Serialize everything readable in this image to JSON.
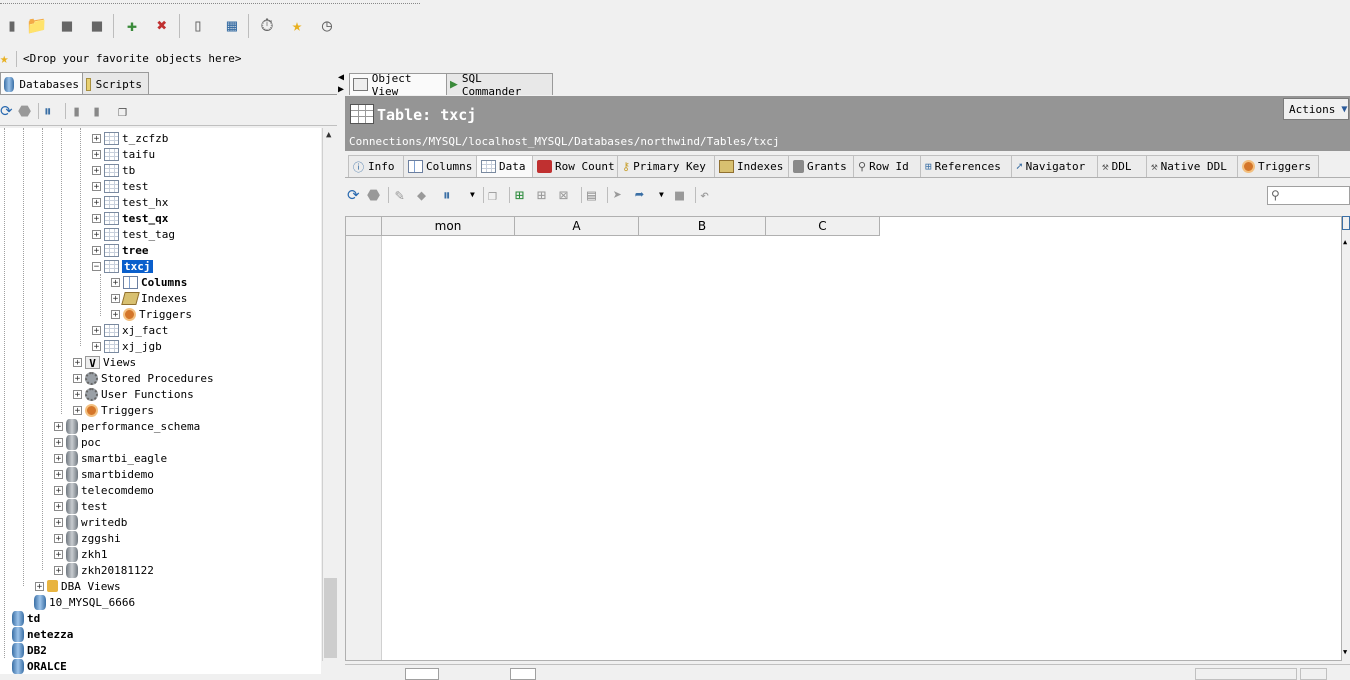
{
  "favorites_bar": {
    "text": "<Drop your favorite objects here>"
  },
  "left_tabs": [
    {
      "label": "Databases"
    },
    {
      "label": "Scripts"
    }
  ],
  "tree": {
    "tables_above": [
      {
        "label": "t_zcfzb",
        "bold": false
      },
      {
        "label": "taifu",
        "bold": false
      },
      {
        "label": "tb",
        "bold": false
      },
      {
        "label": "test",
        "bold": false
      },
      {
        "label": "test_hx",
        "bold": false
      },
      {
        "label": "test_qx",
        "bold": true
      },
      {
        "label": "test_tag",
        "bold": false
      },
      {
        "label": "tree",
        "bold": true
      }
    ],
    "selected_table": "txcj",
    "selected_children": [
      "Columns",
      "Indexes",
      "Triggers"
    ],
    "tables_below": [
      "xj_fact",
      "xj_jgb"
    ],
    "schema_folders": [
      "Views",
      "Stored Procedures",
      "User Functions",
      "Triggers"
    ],
    "databases": [
      "performance_schema",
      "poc",
      "smartbi_eagle",
      "smartbidemo",
      "telecomdemo",
      "test",
      "writedb",
      "zggshi",
      "zkh1",
      "zkh20181122"
    ],
    "dba_views": "DBA Views",
    "connections": [
      "10_MYSQL_6666"
    ],
    "servers": [
      "td",
      "netezza",
      "DB2",
      "ORALCE"
    ]
  },
  "right_tabs": [
    {
      "label": "Object View"
    },
    {
      "label": "SQL Commander"
    }
  ],
  "header": {
    "title": "Table: txcj",
    "path": "Connections/MYSQL/localhost_MYSQL/Databases/northwind/Tables/txcj",
    "actions_label": "Actions"
  },
  "detail_tabs": [
    {
      "label": "Info"
    },
    {
      "label": "Columns"
    },
    {
      "label": "Data"
    },
    {
      "label": "Row Count"
    },
    {
      "label": "Primary Key"
    },
    {
      "label": "Indexes"
    },
    {
      "label": "Grants"
    },
    {
      "label": "Row Id"
    },
    {
      "label": "References"
    },
    {
      "label": "Navigator"
    },
    {
      "label": "DDL"
    },
    {
      "label": "Native DDL"
    },
    {
      "label": "Triggers"
    }
  ],
  "grid": {
    "columns": [
      "mon",
      "A",
      "B",
      "C"
    ]
  },
  "colors": {
    "header_bg": "#959595",
    "selection": "#0a5fcc"
  }
}
